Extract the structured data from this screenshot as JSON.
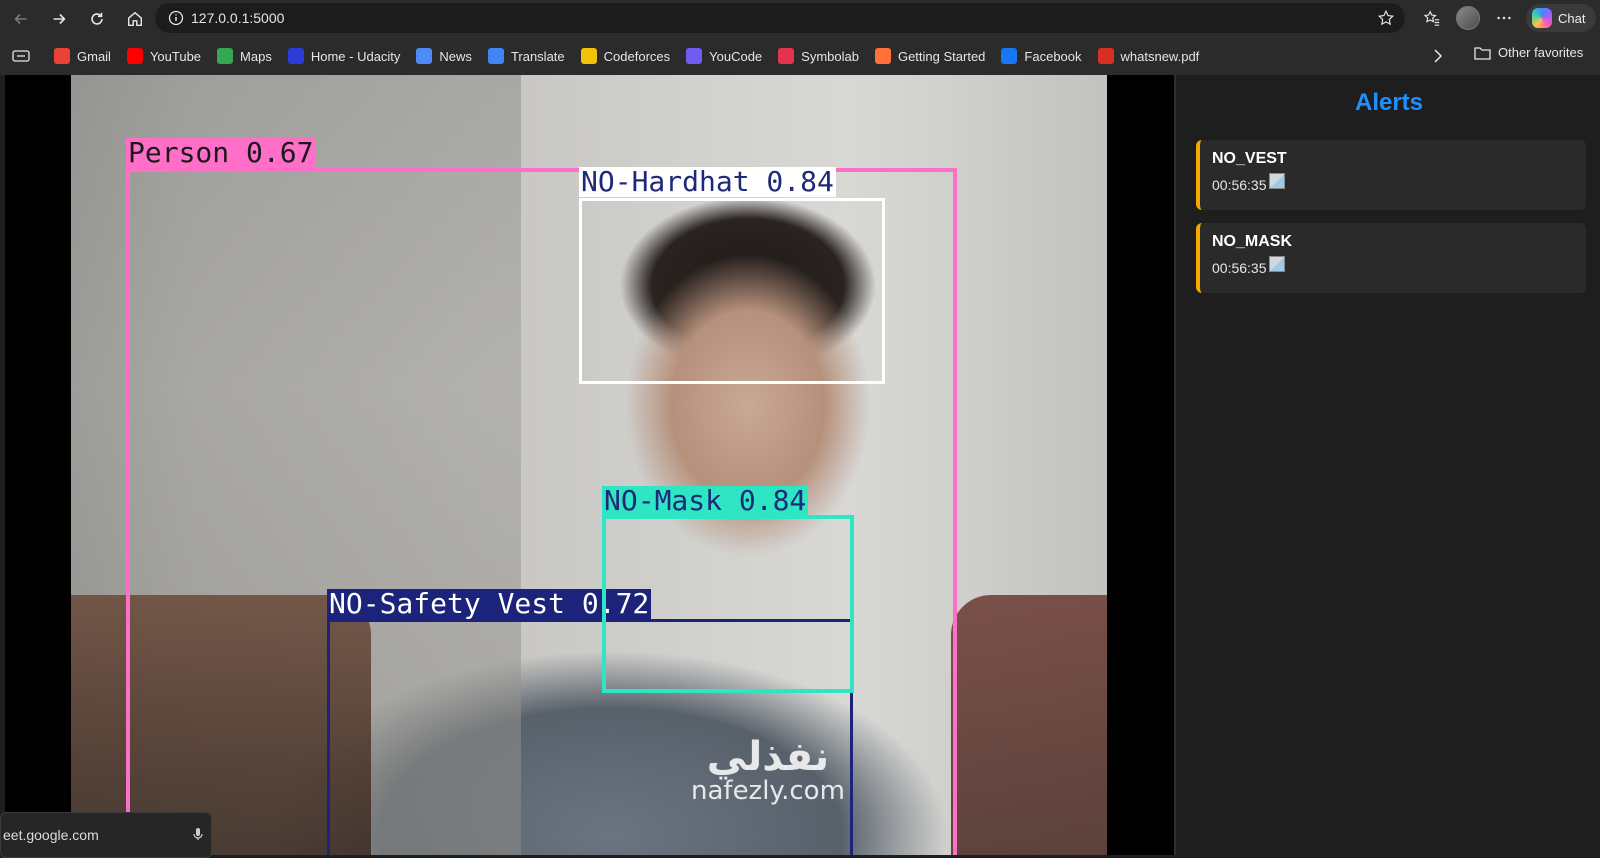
{
  "browser": {
    "url": "127.0.0.1:5000",
    "chat_label": "Chat"
  },
  "bookmarks": {
    "items": [
      {
        "label": "Gmail",
        "icon": "gmail-icon",
        "color": "#ea4335"
      },
      {
        "label": "YouTube",
        "icon": "youtube-icon",
        "color": "#ff0000"
      },
      {
        "label": "Maps",
        "icon": "maps-icon",
        "color": "#34a853"
      },
      {
        "label": "Home - Udacity",
        "icon": "udacity-icon",
        "color": "#2b3bd6"
      },
      {
        "label": "News",
        "icon": "news-icon",
        "color": "#4c8bf5"
      },
      {
        "label": "Translate",
        "icon": "translate-icon",
        "color": "#4285f4"
      },
      {
        "label": "Codeforces",
        "icon": "codeforces-icon",
        "color": "#f4c20d"
      },
      {
        "label": "YouCode",
        "icon": "youcode-icon",
        "color": "#6f5cf0"
      },
      {
        "label": "Symbolab",
        "icon": "symbolab-icon",
        "color": "#e6314f"
      },
      {
        "label": "Getting Started",
        "icon": "firefox-icon",
        "color": "#ff7139"
      },
      {
        "label": "Facebook",
        "icon": "facebook-icon",
        "color": "#1877f2"
      },
      {
        "label": "whatsnew.pdf",
        "icon": "pdf-icon",
        "color": "#d93025"
      }
    ],
    "other_favorites": "Other favorites"
  },
  "detections": [
    {
      "label": "Person 0.67",
      "color": "#ff6ec7",
      "text_color": "#1a1a1a"
    },
    {
      "label": "NO-Hardhat 0.84",
      "color": "#ffffff",
      "text_color": "#1e2a78"
    },
    {
      "label": "NO-Mask 0.84",
      "color": "#2ee6c4",
      "text_color": "#1e2a78"
    },
    {
      "label": "NO-Safety Vest 0.72",
      "color": "#1c237a",
      "text_color": "#ffffff"
    }
  ],
  "watermark": {
    "arabic": "نفذلي",
    "latin": "nafezly.com"
  },
  "popup": {
    "text": "eet.google.com"
  },
  "alerts": {
    "title": "Alerts",
    "accent_color": "#f5a800",
    "title_color": "#1e90ff",
    "items": [
      {
        "type": "NO_VEST",
        "time": "00:56:35"
      },
      {
        "type": "NO_MASK",
        "time": "00:56:35"
      }
    ]
  }
}
